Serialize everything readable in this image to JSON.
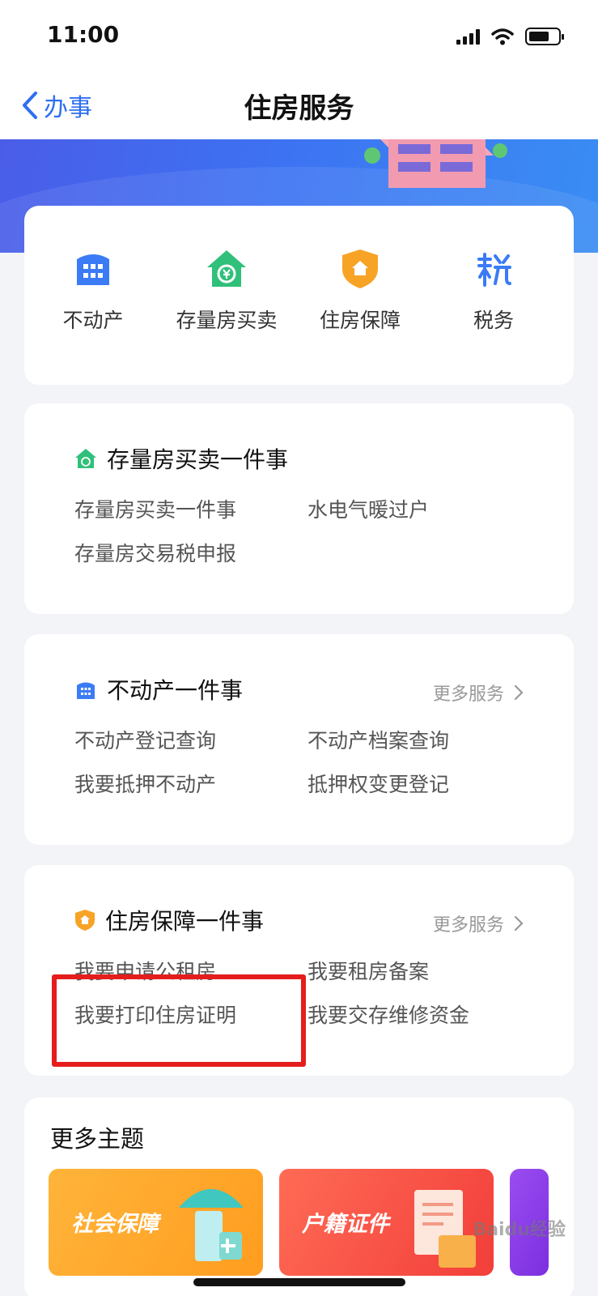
{
  "status_bar": {
    "time": "11:00"
  },
  "nav": {
    "back_label": "办事",
    "title": "住房服务"
  },
  "quick_services": [
    {
      "label": "不动产",
      "icon": "building-icon",
      "color": "#3b7bf6"
    },
    {
      "label": "存量房买卖",
      "icon": "house-yuan-icon",
      "color": "#30c07a"
    },
    {
      "label": "住房保障",
      "icon": "shield-house-icon",
      "color": "#f7a325"
    },
    {
      "label": "税务",
      "icon": "tax-icon",
      "color": "#3b7bf6"
    }
  ],
  "sections": {
    "existing_housing": {
      "title": "存量房买卖一件事",
      "links": [
        "存量房买卖一件事",
        "水电气暖过户",
        "存量房交易税申报"
      ]
    },
    "real_estate": {
      "title": "不动产一件事",
      "more": "更多服务",
      "links": [
        "不动产登记查询",
        "不动产档案查询",
        "我要抵押不动产",
        "抵押权变更登记"
      ]
    },
    "housing_security": {
      "title": "住房保障一件事",
      "more": "更多服务",
      "links": [
        "我要申请公租房",
        "我要租房备案",
        "我要打印住房证明",
        "我要交存维修资金"
      ]
    }
  },
  "more_topics": {
    "title": "更多主题",
    "tiles": [
      "社会保障",
      "户籍证件"
    ]
  },
  "watermark": "Baidu经验"
}
